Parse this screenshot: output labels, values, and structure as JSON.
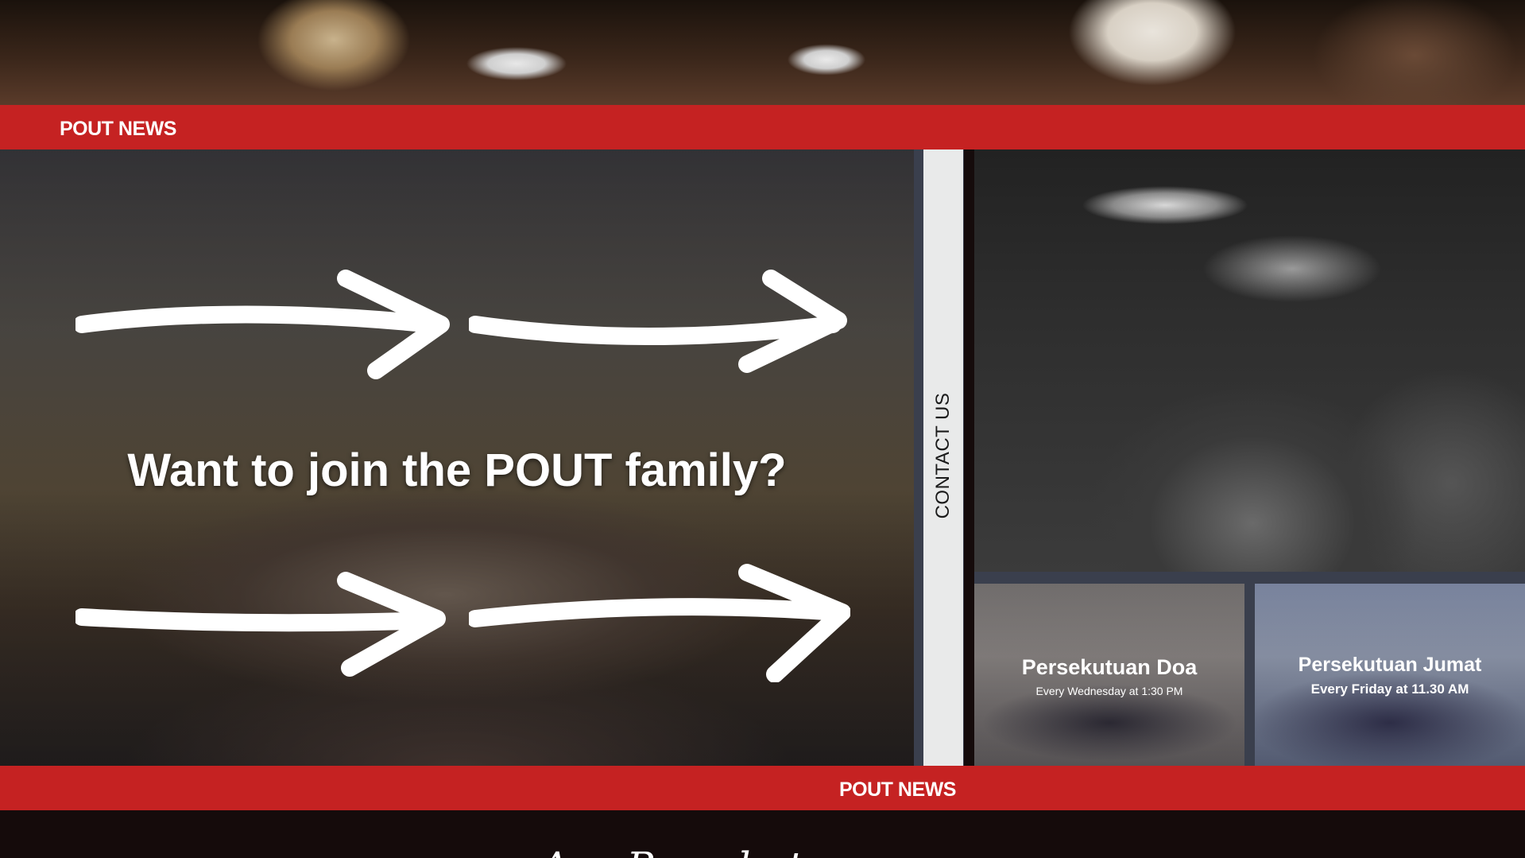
{
  "hero": {
    "image": "group-sitting-floor-photo"
  },
  "news_top": {
    "label": "POUT NEWS"
  },
  "join": {
    "title": "Want to join the POUT family?",
    "image": "group-photo-hall"
  },
  "contact": {
    "label": "CONTACT US"
  },
  "worship": {
    "image": "raised-hands-worship-photo"
  },
  "events": [
    {
      "title": "Persekutuan Doa",
      "when": "Every Wednesday at 1:30 PM"
    },
    {
      "title": "Persekutuan Jumat",
      "when": "Every Friday at 11.30 AM"
    }
  ],
  "news_bottom": {
    "label": "POUT NEWS"
  },
  "footer": {
    "script": "Ayo Persekutuan"
  },
  "colors": {
    "red": "#c52222",
    "dark": "#150b0b",
    "slate": "#3a3f4d"
  }
}
